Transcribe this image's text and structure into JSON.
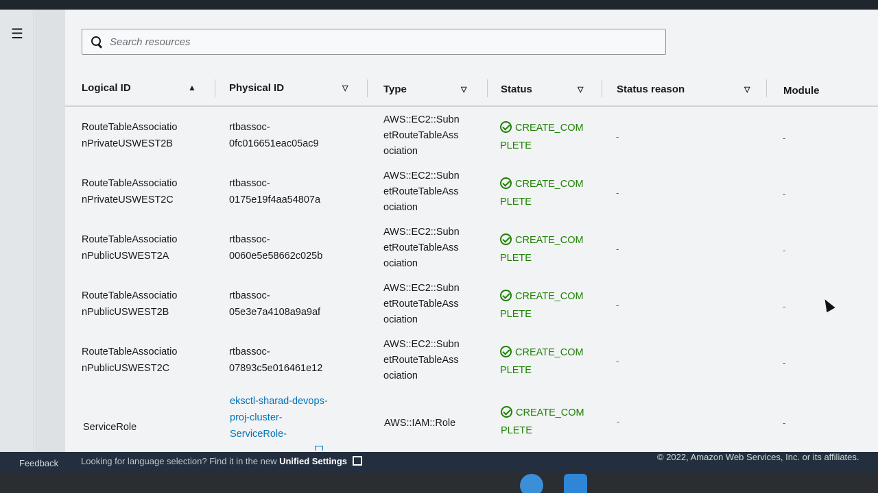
{
  "nav": {
    "menu_icon": "hamburger-menu-icon"
  },
  "search": {
    "placeholder": "Search resources",
    "icon": "search-icon"
  },
  "table": {
    "columns": [
      "Logical ID",
      "Physical ID",
      "Type",
      "Status",
      "Status reason",
      "Module"
    ],
    "sort_column": "Logical ID",
    "sort_direction": "ascending",
    "rows": [
      {
        "logical_id_line1": "RouteTableAssociatio",
        "logical_id_line2": "nPrivateUSWEST2B",
        "physical_id_line1": "rtbassoc-",
        "physical_id_line2": "0fc016651eac05ac9",
        "type_line1": "AWS::EC2::Subn",
        "type_line2": "etRouteTableAss",
        "type_line3": "ociation",
        "status_line1": "CREATE_COM",
        "status_line2": "PLETE",
        "status_reason": "-",
        "module": "-"
      },
      {
        "logical_id_line1": "RouteTableAssociatio",
        "logical_id_line2": "nPrivateUSWEST2C",
        "physical_id_line1": "rtbassoc-",
        "physical_id_line2": "0175e19f4aa54807a",
        "type_line1": "AWS::EC2::Subn",
        "type_line2": "etRouteTableAss",
        "type_line3": "ociation",
        "status_line1": "CREATE_COM",
        "status_line2": "PLETE",
        "status_reason": "-",
        "module": "-"
      },
      {
        "logical_id_line1": "RouteTableAssociatio",
        "logical_id_line2": "nPublicUSWEST2A",
        "physical_id_line1": "rtbassoc-",
        "physical_id_line2": "0060e5e58662c025b",
        "type_line1": "AWS::EC2::Subn",
        "type_line2": "etRouteTableAss",
        "type_line3": "ociation",
        "status_line1": "CREATE_COM",
        "status_line2": "PLETE",
        "status_reason": "-",
        "module": "-"
      },
      {
        "logical_id_line1": "RouteTableAssociatio",
        "logical_id_line2": "nPublicUSWEST2B",
        "physical_id_line1": "rtbassoc-",
        "physical_id_line2": "05e3e7a4108a9a9af",
        "type_line1": "AWS::EC2::Subn",
        "type_line2": "etRouteTableAss",
        "type_line3": "ociation",
        "status_line1": "CREATE_COM",
        "status_line2": "PLETE",
        "status_reason": "-",
        "module": "-"
      },
      {
        "logical_id_line1": "RouteTableAssociatio",
        "logical_id_line2": "nPublicUSWEST2C",
        "physical_id_line1": "rtbassoc-",
        "physical_id_line2": "07893c5e016461e12",
        "type_line1": "AWS::EC2::Subn",
        "type_line2": "etRouteTableAss",
        "type_line3": "ociation",
        "status_line1": "CREATE_COM",
        "status_line2": "PLETE",
        "status_reason": "-",
        "module": "-"
      }
    ],
    "service_role_row": {
      "logical_id": "ServiceRole",
      "physical_id_line1": "eksctl-sharad-devops-",
      "physical_id_line2": "proj-cluster-",
      "physical_id_line3": "ServiceRole-",
      "type": "AWS::IAM::Role",
      "status_line1": "CREATE_COM",
      "status_line2": "PLETE",
      "status_reason": "-",
      "module": "-"
    }
  },
  "footer": {
    "feedback": "Feedback",
    "language_prompt": "Looking for language selection? Find it in the new",
    "unified_settings": "Unified Settings",
    "copyright": "© 2022, Amazon Web Services, Inc. or its affiliates."
  },
  "colors": {
    "status_success": "#1d8102",
    "link": "#0073bb",
    "footer_bg": "#232f3e"
  }
}
